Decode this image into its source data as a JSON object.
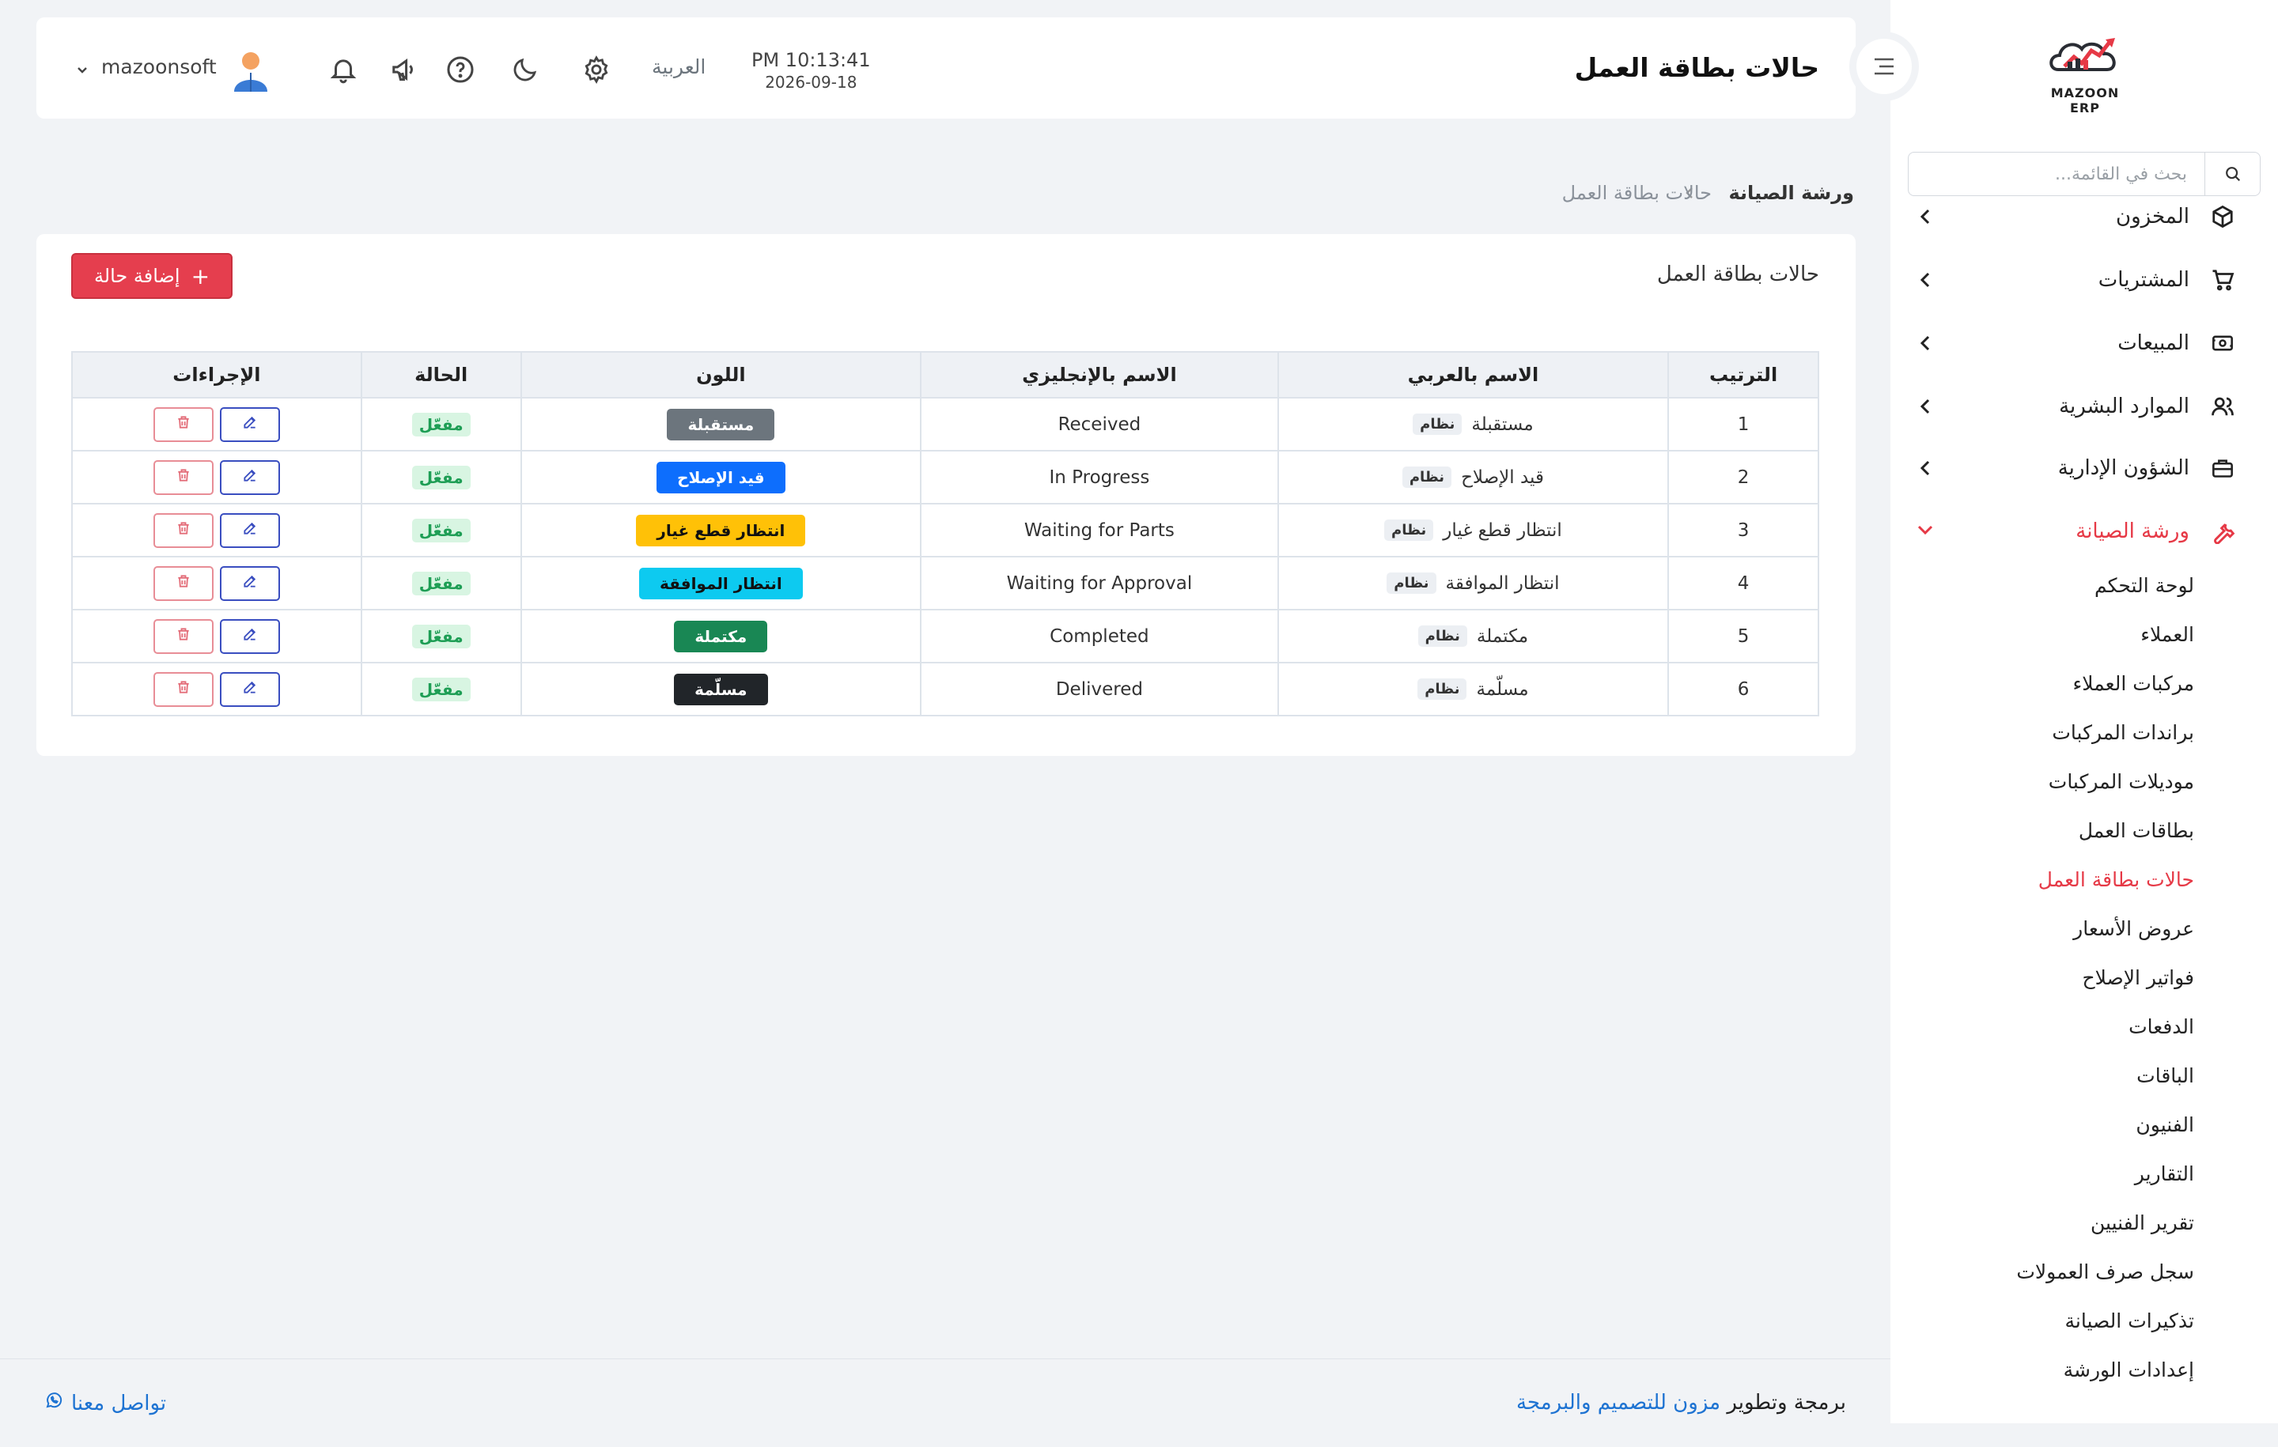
{
  "sidebar": {
    "logo_text": "MAZOON ERP",
    "search_placeholder": "بحث في القائمة...",
    "menu": [
      {
        "label": "المخزون",
        "icon": "box-icon"
      },
      {
        "label": "المشتريات",
        "icon": "cart-icon"
      },
      {
        "label": "المبيعات",
        "icon": "cash-icon"
      },
      {
        "label": "الموارد البشرية",
        "icon": "users-icon"
      },
      {
        "label": "الشؤون الإدارية",
        "icon": "briefcase-icon"
      },
      {
        "label": "ورشة الصيانة",
        "icon": "wrench-icon",
        "active": true
      }
    ],
    "submenu": [
      "لوحة التحكم",
      "العملاء",
      "مركبات العملاء",
      "براندات المركبات",
      "موديلات المركبات",
      "بطاقات العمل",
      "حالات بطاقة العمل",
      "عروض الأسعار",
      "فواتير الإصلاح",
      "الدفعات",
      "الباقات",
      "الفنيون",
      "التقارير",
      "تقرير الفنيين",
      "سجل صرف العمولات",
      "تذكيرات الصيانة",
      "إعدادات الورشة"
    ],
    "active_submenu_index": 6
  },
  "header": {
    "title": "حالات بطاقة العمل",
    "time": "PM 10:13:41",
    "date": "2026-09-18",
    "language": "العربية",
    "username": "mazoonsoft"
  },
  "breadcrumb": {
    "parent": "ورشة الصيانة",
    "current": "حالات بطاقة العمل"
  },
  "card": {
    "title": "حالات بطاقة العمل",
    "add_button": "إضافة حالة"
  },
  "table": {
    "headers": [
      "الترتيب",
      "الاسم بالعربي",
      "الاسم بالإنجليزي",
      "اللون",
      "الحالة",
      "الإجراءات"
    ],
    "system_badge": "نظام",
    "rows": [
      {
        "order": "1",
        "ar": "مستقبلة",
        "en": "Received",
        "color_label": "مستقبلة",
        "color": "#6c757d",
        "text_color": "#ffffff",
        "status": "مفعّل"
      },
      {
        "order": "2",
        "ar": "قيد الإصلاح",
        "en": "In Progress",
        "color_label": "قيد الإصلاح",
        "color": "#0d6efd",
        "text_color": "#ffffff",
        "status": "مفعّل"
      },
      {
        "order": "3",
        "ar": "انتظار قطع غيار",
        "en": "Waiting for Parts",
        "color_label": "انتظار قطع غيار",
        "color": "#ffc107",
        "text_color": "#111111",
        "status": "مفعّل"
      },
      {
        "order": "4",
        "ar": "انتظار الموافقة",
        "en": "Waiting for Approval",
        "color_label": "انتظار الموافقة",
        "color": "#0dcaf0",
        "text_color": "#111111",
        "status": "مفعّل"
      },
      {
        "order": "5",
        "ar": "مكتملة",
        "en": "Completed",
        "color_label": "مكتملة",
        "color": "#198754",
        "text_color": "#ffffff",
        "status": "مفعّل"
      },
      {
        "order": "6",
        "ar": "مسلّمة",
        "en": "Delivered",
        "color_label": "مسلّمة",
        "color": "#212529",
        "text_color": "#ffffff",
        "status": "مفعّل"
      }
    ]
  },
  "footer": {
    "prefix": "برمجة وتطوير",
    "brand": "مزون للتصميم والبرمجة",
    "contact": "تواصل معنا"
  }
}
